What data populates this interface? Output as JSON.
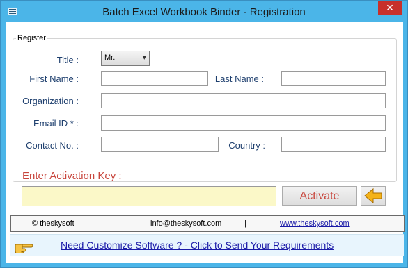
{
  "window": {
    "title": "Batch Excel Workbook Binder - Registration",
    "close_glyph": "✕"
  },
  "register": {
    "legend": "Register",
    "title_label": "Title :",
    "title_value": "Mr.",
    "title_options": [
      "Mr."
    ],
    "first_name_label": "First Name :",
    "first_name_value": "",
    "last_name_label": "Last Name :",
    "last_name_value": "",
    "organization_label": "Organization :",
    "organization_value": "",
    "email_label": "Email ID * :",
    "email_value": "",
    "contact_label": "Contact No. :",
    "contact_value": "",
    "country_label": "Country :",
    "country_value": ""
  },
  "activation": {
    "label": "Enter Activation Key  :",
    "key_value": "",
    "activate_label": "Activate",
    "back_icon": "arrow-left-icon"
  },
  "footer": {
    "copyright": "© theskysoft",
    "sep1": "|",
    "email": "info@theskysoft.com",
    "sep2": "|",
    "website": "www.theskysoft.com"
  },
  "requirements": {
    "hand_icon": "pointing-hand-icon",
    "link_text": "Need Customize Software ? - Click to Send Your Requirements"
  },
  "colors": {
    "window_frame": "#4bb5e8",
    "label_text": "#1e3f6e",
    "activation_red": "#c8463d",
    "key_field_bg": "#fbf8c8",
    "link_blue": "#1a1aa8",
    "close_button": "#c7302b"
  }
}
